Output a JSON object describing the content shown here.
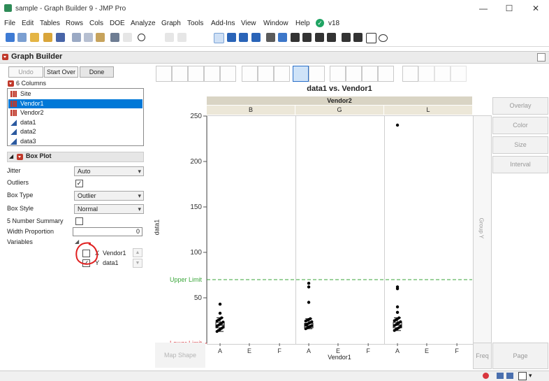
{
  "window": {
    "title": "sample - Graph Builder 9 - JMP Pro",
    "controls": [
      "—",
      "☐",
      "✕"
    ]
  },
  "menu": [
    "File",
    "Edit",
    "Tables",
    "Rows",
    "Cols",
    "DOE",
    "Analyze",
    "Graph",
    "Tools",
    "Add-Ins",
    "View",
    "Window",
    "Help"
  ],
  "menu_version": "v18",
  "header": {
    "title": "Graph Builder"
  },
  "actions": {
    "undo": "Undo",
    "start_over": "Start Over",
    "done": "Done"
  },
  "columns": {
    "header": "6 Columns",
    "items": [
      {
        "name": "Site",
        "kind": "nominal"
      },
      {
        "name": "Vendor1",
        "kind": "nominal",
        "selected": true
      },
      {
        "name": "Vendor2",
        "kind": "nominal"
      },
      {
        "name": "data1",
        "kind": "continuous"
      },
      {
        "name": "data2",
        "kind": "continuous"
      },
      {
        "name": "data3",
        "kind": "continuous"
      }
    ]
  },
  "boxplot": {
    "title": "Box Plot",
    "jitter_label": "Jitter",
    "jitter_value": "Auto",
    "outliers_label": "Outliers",
    "outliers_checked": true,
    "boxtype_label": "Box Type",
    "boxtype_value": "Outlier",
    "boxstyle_label": "Box Style",
    "boxstyle_value": "Normal",
    "fivenum_label": "5 Number Summary",
    "width_label": "Width Proportion",
    "width_value": "0",
    "variables_label": "Variables",
    "var1_role": "X",
    "var1": "Vendor1",
    "var2_role": "Y",
    "var2": "data1"
  },
  "graph": {
    "title": "data1 vs. Vendor1",
    "group_x": "Vendor2",
    "group_x_levels": [
      "B",
      "G",
      "L"
    ],
    "x_title": "Vendor1",
    "x_ticks": [
      "A",
      "E",
      "F"
    ],
    "y_title": "data1",
    "group_y": "Group Y",
    "map_shape": "Map Shape",
    "freq": "Freq",
    "page": "Page",
    "upper_limit_label": "Upper Limit",
    "lower_limit_label": "Lower Limit",
    "colors": {
      "upper_limit": "#3aa63a",
      "lower_limit": "#d9363e"
    }
  },
  "zones": [
    "Overlay",
    "Color",
    "Size",
    "Interval"
  ],
  "chart_data": {
    "type": "box",
    "title": "data1 vs. Vendor1",
    "xlabel": "Vendor1",
    "ylabel": "data1",
    "ylim": [
      0,
      250
    ],
    "y_ticks": [
      50,
      100,
      150,
      200,
      250
    ],
    "categories": [
      "A",
      "E",
      "F"
    ],
    "group_by": "Vendor2",
    "reference_lines": [
      {
        "label": "Upper Limit",
        "value": 70
      },
      {
        "label": "Lower Limit",
        "value": 0
      }
    ],
    "panels": [
      {
        "group": "B",
        "category": "A",
        "box": {
          "q1": 17,
          "median": 20,
          "q3": 23
        },
        "whiskers": [
          13,
          28
        ],
        "outliers": [
          33,
          43
        ]
      },
      {
        "group": "G",
        "category": "A",
        "box": {
          "q1": 17,
          "median": 19,
          "q3": 22
        },
        "whiskers": [
          16,
          27
        ],
        "outliers": [
          45,
          62,
          66
        ]
      },
      {
        "group": "L",
        "category": "A",
        "box": {
          "q1": 17,
          "median": 20,
          "q3": 23
        },
        "whiskers": [
          14,
          28
        ],
        "outliers": [
          34,
          40,
          60,
          62,
          240
        ]
      }
    ]
  }
}
